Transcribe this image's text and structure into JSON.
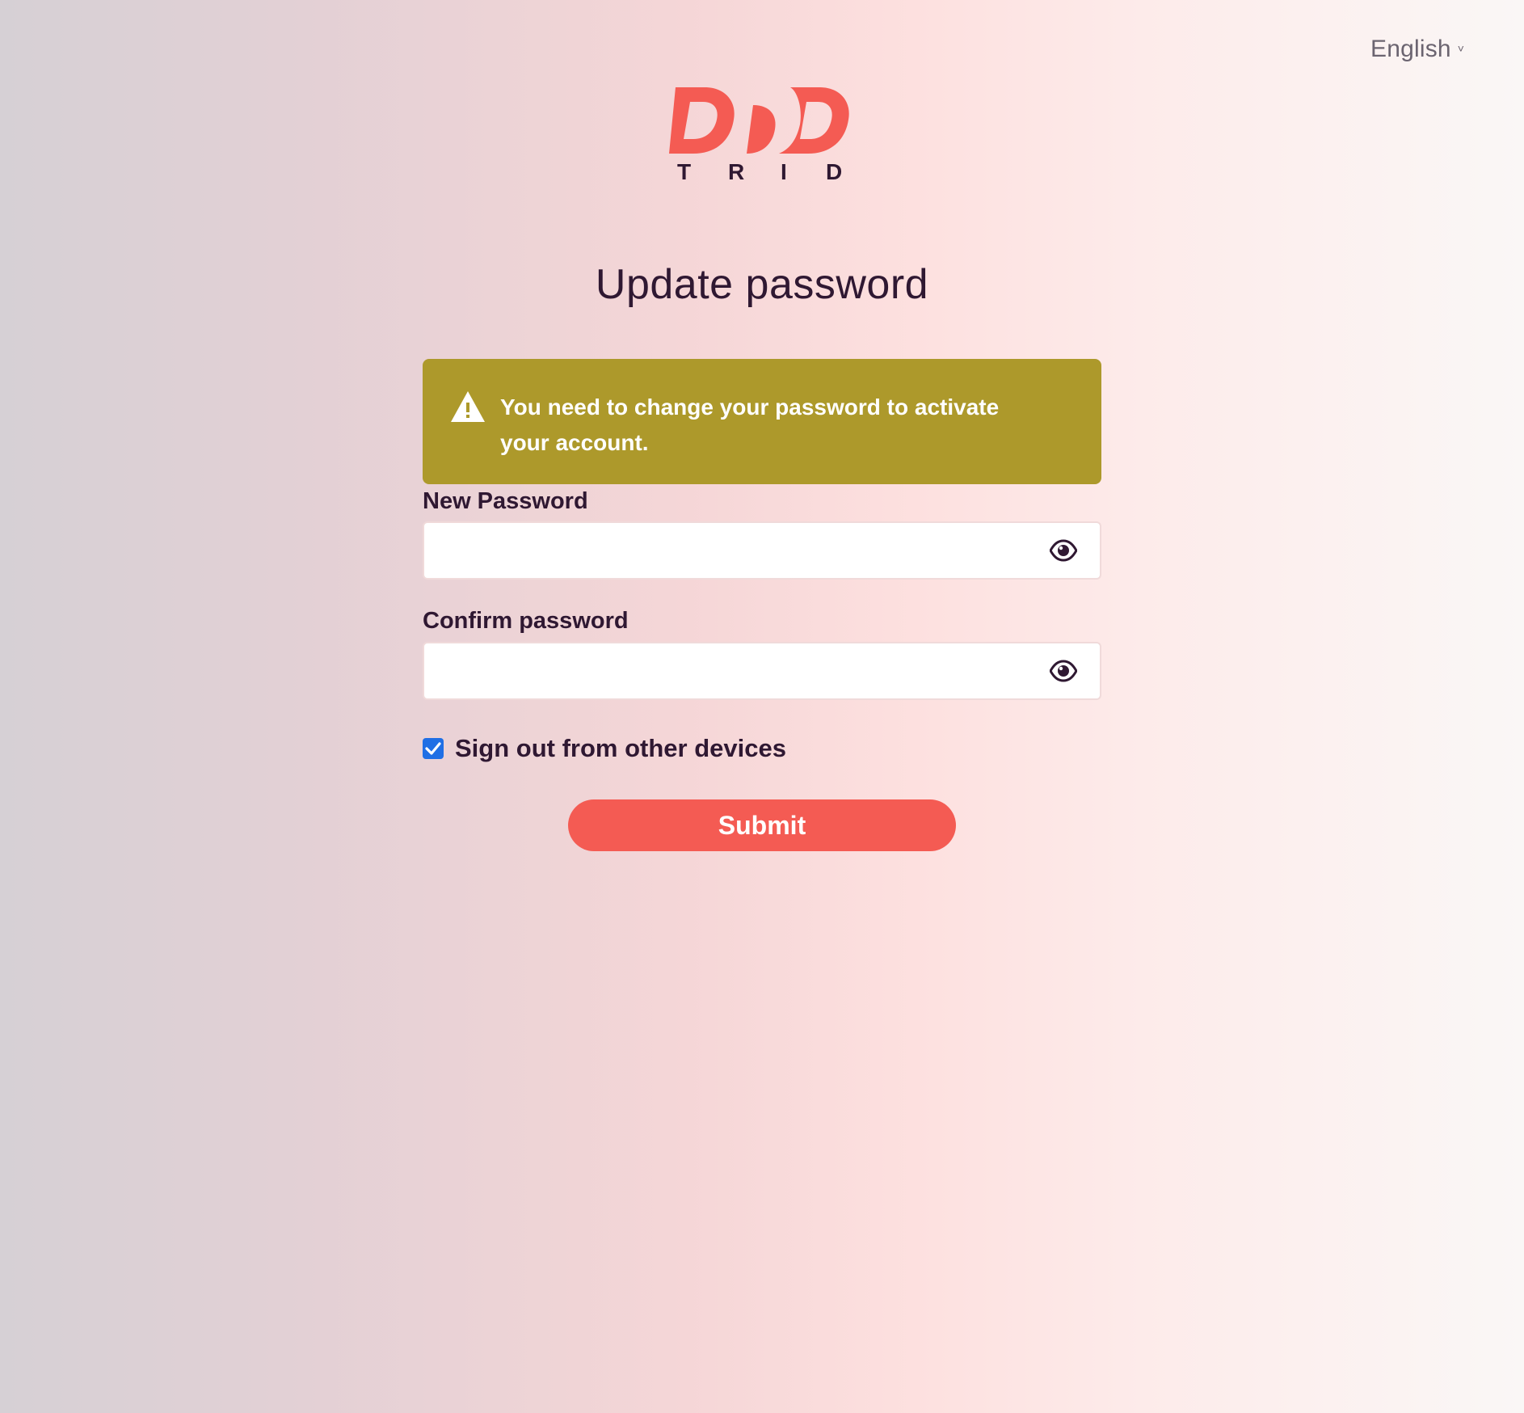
{
  "header": {
    "language": "English",
    "language_chevron": "˅"
  },
  "logo": {
    "wordmark": "DDD",
    "subtitle": "TRID",
    "subtitle_letters": [
      "T",
      "R",
      "I",
      "D"
    ],
    "color": "#f45b53",
    "text_color": "#2f1832"
  },
  "page": {
    "title": "Update password"
  },
  "alert": {
    "icon": "warning-triangle-icon",
    "message": "You need to change your password to activate your account.",
    "color": "#ad992b"
  },
  "form": {
    "new_password": {
      "label": "New Password",
      "value": "",
      "toggle_icon": "eye-icon"
    },
    "confirm_password": {
      "label": "Confirm password",
      "value": "",
      "toggle_icon": "eye-icon"
    },
    "sign_out_checkbox": {
      "label": "Sign out from other devices",
      "checked": true
    },
    "submit_label": "Submit"
  },
  "colors": {
    "accent": "#f45b53",
    "text": "#2f1832",
    "checkbox": "#1f6fe5"
  }
}
